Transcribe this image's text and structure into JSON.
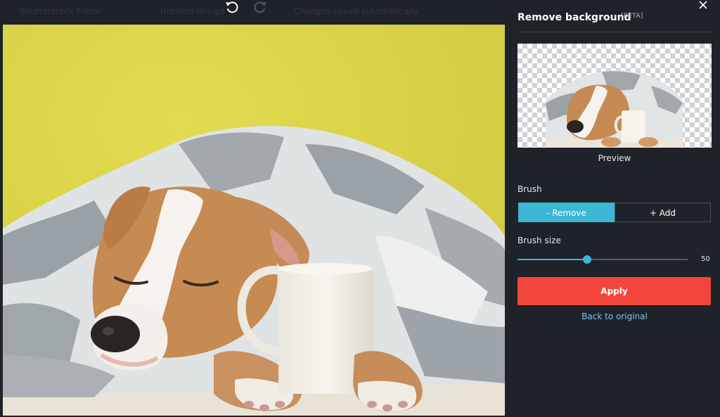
{
  "topbar": {
    "faded_left": "Shutterstock Editor",
    "faded_mid": "Untitled design",
    "faded_right": "Changes saved automatically",
    "undo_icon": "undo-icon",
    "redo_icon": "redo-icon"
  },
  "panel": {
    "title": "Remove background",
    "badge": "BETA",
    "close_icon": "close-icon",
    "preview_label": "Preview",
    "brush_label": "Brush",
    "brush_options": [
      "- Remove",
      "+ Add"
    ],
    "brush_selected": "- Remove",
    "brush_size_label": "Brush size",
    "brush_size_value": "50",
    "brush_size_fraction": 0.41,
    "apply_label": "Apply",
    "back_label": "Back to original"
  },
  "colors": {
    "accent": "#3bb7d4",
    "apply": "#f2463c",
    "link": "#6fcde6",
    "panel_bg": "#1f2228",
    "photo_bg": "#dcd545"
  }
}
